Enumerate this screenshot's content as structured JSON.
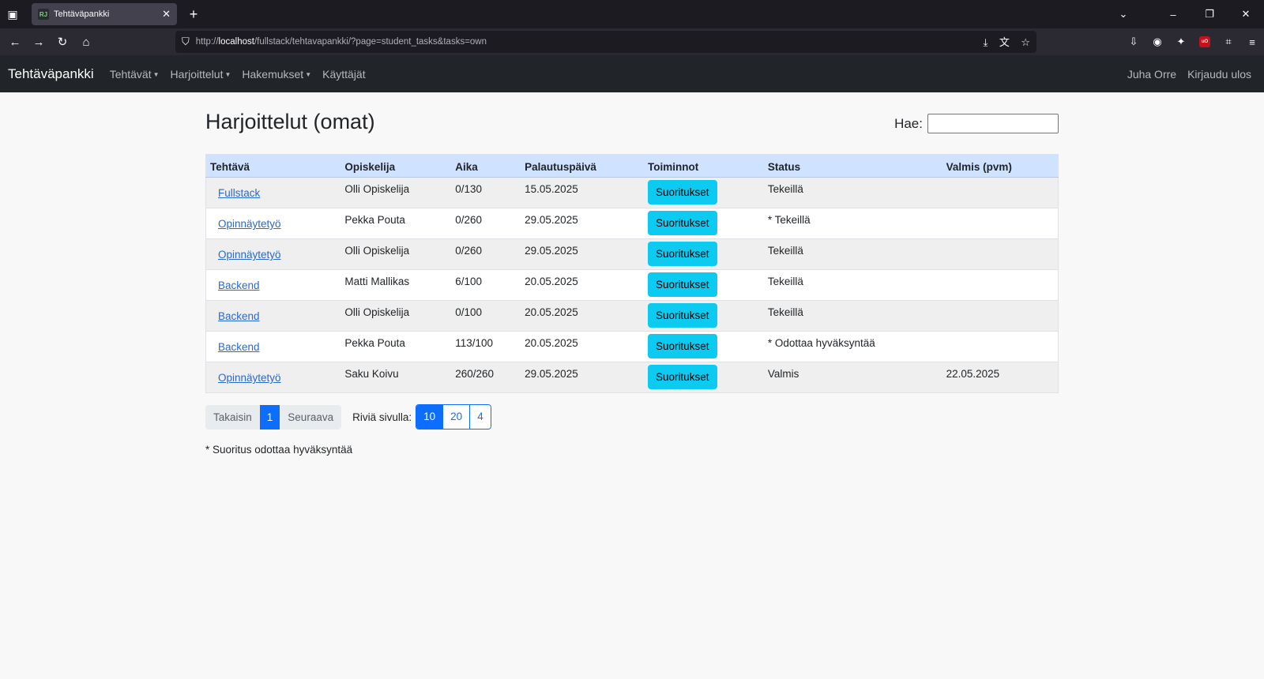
{
  "browser": {
    "tab_title": "Tehtäväpankki",
    "favicon_text": "RJ",
    "url_prefix": "http://",
    "url_host": "localhost",
    "url_path": "/fullstack/tehtavapankki/?page=student_tasks&tasks=own"
  },
  "nav": {
    "brand": "Tehtäväpankki",
    "menu": [
      "Tehtävät",
      "Harjoittelut",
      "Hakemukset",
      "Käyttäjät"
    ],
    "user": "Juha Orre",
    "logout": "Kirjaudu ulos"
  },
  "page": {
    "title": "Harjoittelut (omat)",
    "search_label": "Hae:",
    "search_value": ""
  },
  "table": {
    "headers": [
      "Tehtävä",
      "Opiskelija",
      "Aika",
      "Palautuspäivä",
      "Toiminnot",
      "Status",
      "Valmis (pvm)"
    ],
    "rows": [
      {
        "task": "Fullstack",
        "student": "Olli Opiskelija",
        "time": "0/130",
        "due": "15.05.2025",
        "action": "Suoritukset",
        "status": "Tekeillä",
        "done": ""
      },
      {
        "task": "Opinnäytetyö",
        "student": "Pekka Pouta",
        "time": "0/260",
        "due": "29.05.2025",
        "action": "Suoritukset",
        "status": "* Tekeillä",
        "done": ""
      },
      {
        "task": "Opinnäytetyö",
        "student": "Olli Opiskelija",
        "time": "0/260",
        "due": "29.05.2025",
        "action": "Suoritukset",
        "status": "Tekeillä",
        "done": ""
      },
      {
        "task": "Backend",
        "student": "Matti Mallikas",
        "time": "6/100",
        "due": "20.05.2025",
        "action": "Suoritukset",
        "status": "Tekeillä",
        "done": ""
      },
      {
        "task": "Backend",
        "student": "Olli Opiskelija",
        "time": "0/100",
        "due": "20.05.2025",
        "action": "Suoritukset",
        "status": "Tekeillä",
        "done": ""
      },
      {
        "task": "Backend",
        "student": "Pekka Pouta",
        "time": "113/100",
        "due": "20.05.2025",
        "action": "Suoritukset",
        "status": "* Odottaa hyväksyntää",
        "done": ""
      },
      {
        "task": "Opinnäytetyö",
        "student": "Saku Koivu",
        "time": "260/260",
        "due": "29.05.2025",
        "action": "Suoritukset",
        "status": "Valmis",
        "done": "22.05.2025"
      }
    ]
  },
  "pagination": {
    "prev": "Takaisin",
    "current": "1",
    "next": "Seuraava",
    "rows_label": "Riviä sivulla:",
    "rows_options": [
      "10",
      "20",
      "4"
    ],
    "rows_selected": "10"
  },
  "footnote": "* Suoritus odottaa hyväksyntää",
  "colors": {
    "navbar": "#212529",
    "table_header": "#cfe2ff",
    "button_info": "#0dcaf0",
    "primary": "#0d6efd"
  }
}
